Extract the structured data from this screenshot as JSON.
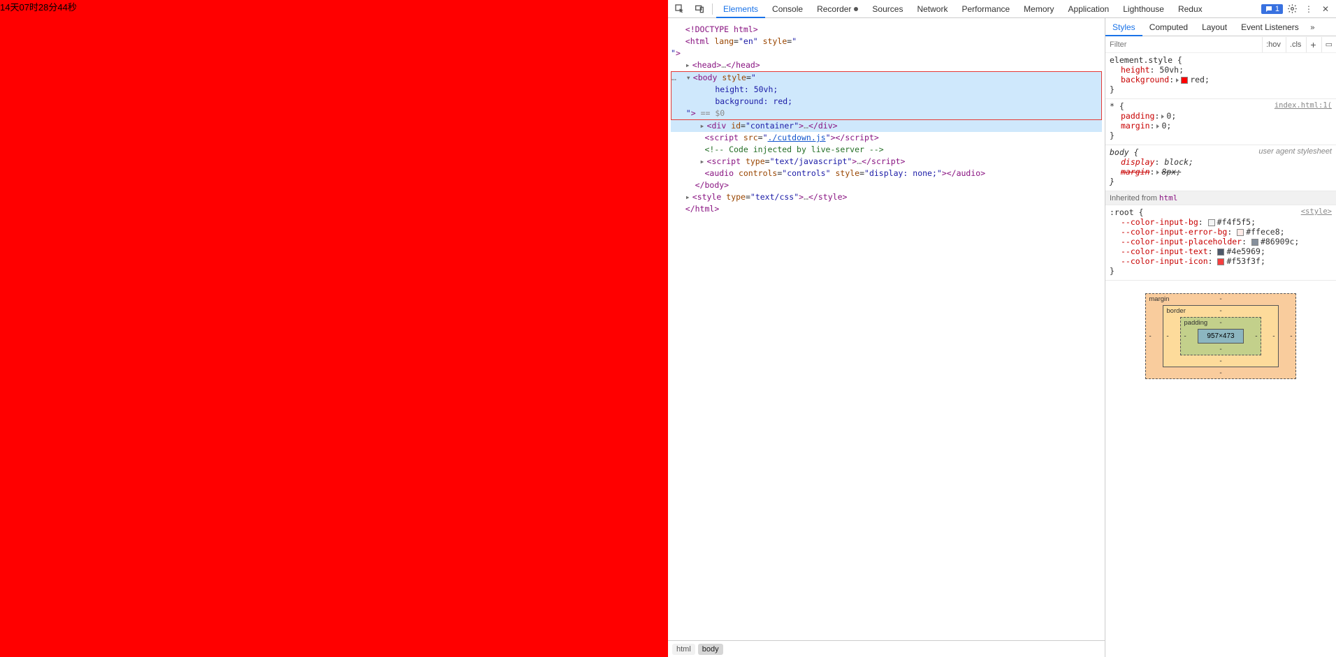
{
  "page": {
    "countdown": "14天07时28分44秒"
  },
  "tabs": {
    "elements": "Elements",
    "console": "Console",
    "recorder": "Recorder",
    "sources": "Sources",
    "network": "Network",
    "performance": "Performance",
    "memory": "Memory",
    "application": "Application",
    "lighthouse": "Lighthouse",
    "redux": "Redux"
  },
  "issue_count": "1",
  "dom": {
    "doctype": "<!DOCTYPE html>",
    "html_open": "<html lang=\"en\" style=\"",
    "html_open2": "\">",
    "head": "<head>…</head>",
    "body_open": "<body style=\"",
    "body_s1": "height: 50vh;",
    "body_s2": "background: red;",
    "body_close_attr": "\"> == $0",
    "div": "<div id=\"container\">…</div>",
    "script1_a": "<script src=\"",
    "script1_link": "./cutdown.js",
    "script1_b": "\"></scr",
    "script1_c": "ipt>",
    "comment": "<!-- Code injected by live-server -->",
    "script2": "<script type=\"text/javascript\">…</scr",
    "script2b": "ipt>",
    "audio": "<audio controls=\"controls\" style=\"display: none;\"></audio>",
    "body_end": "</body>",
    "style": "<style type=\"text/css\">…</style>",
    "html_end": "</html>"
  },
  "crumbs": {
    "html": "html",
    "body": "body"
  },
  "styles_panel": {
    "tabs": {
      "styles": "Styles",
      "computed": "Computed",
      "layout": "Layout",
      "events": "Event Listeners"
    },
    "filter_ph": "Filter",
    "hov": ":hov",
    "cls": ".cls"
  },
  "rules": {
    "es": {
      "sel": "element.style {",
      "p1n": "height",
      "p1v": "50vh",
      "p2n": "background",
      "p2v": "red",
      "close": "}"
    },
    "star": {
      "sel": "* {",
      "src": "index.html:1(",
      "p1n": "padding",
      "p1v": "0",
      "p2n": "margin",
      "p2v": "0",
      "close": "}"
    },
    "body": {
      "sel": "body {",
      "ua": "user agent stylesheet",
      "p1n": "display",
      "p1v": "block",
      "p2n": "margin",
      "p2v": "8px",
      "close": "}"
    },
    "inherit": "Inherited from ",
    "inherit_el": "html",
    "root": {
      "sel": ":root {",
      "src": "<style>",
      "v1": "--color-input-bg",
      "c1": "#f4f5f5",
      "v2": "--color-input-error-bg",
      "c2": "#ffece8",
      "v3": "--color-input-placeholder",
      "c3": "#86909c",
      "v4": "--color-input-text",
      "c4": "#4e5969",
      "v5": "--color-input-icon",
      "c5": "#f53f3f",
      "close": "}"
    }
  },
  "boxmodel": {
    "margin": "margin",
    "border": "border",
    "padding": "padding",
    "content": "957×473",
    "dash": "-"
  }
}
